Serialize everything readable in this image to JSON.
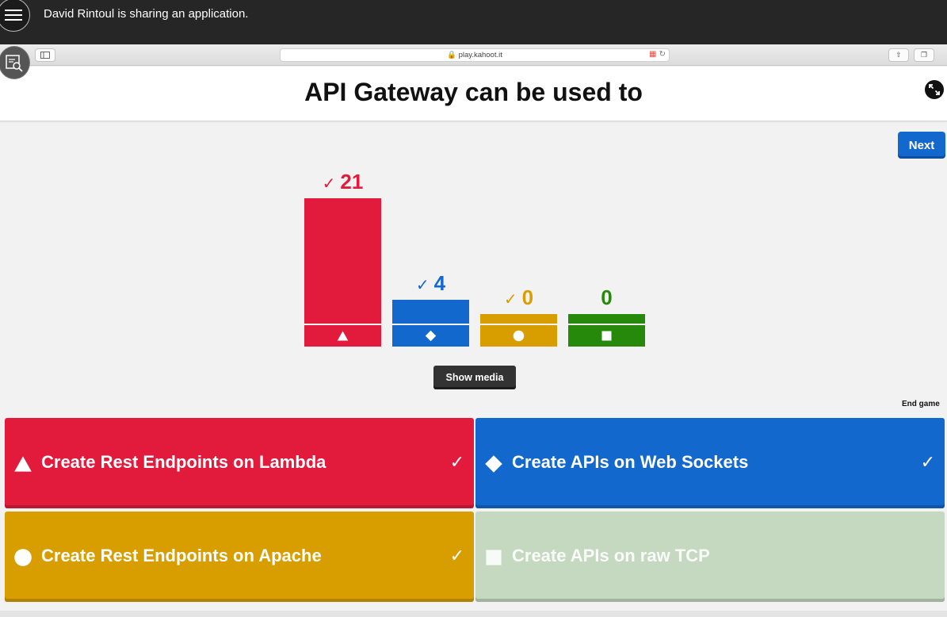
{
  "share_bar": {
    "message": "David Rintoul is sharing an application."
  },
  "browser": {
    "url": "play.kahoot.it"
  },
  "question": {
    "title": "API Gateway can be used to"
  },
  "controls": {
    "next_label": "Next",
    "show_media_label": "Show media",
    "end_game_label": "End game"
  },
  "colors": {
    "red": "#e21b3c",
    "blue": "#1368ce",
    "yellow": "#d89e00",
    "green": "#26890c",
    "green_faded": "#c5d9c0"
  },
  "chart_data": {
    "type": "bar",
    "categories": [
      "triangle",
      "diamond",
      "circle",
      "square"
    ],
    "values": [
      21,
      4,
      0,
      0
    ],
    "correct": [
      true,
      true,
      true,
      false
    ],
    "ylim": [
      0,
      21
    ]
  },
  "answers": [
    {
      "shape": "triangle",
      "text": "Create Rest Endpoints on Lambda",
      "correct": true,
      "faded": false
    },
    {
      "shape": "diamond",
      "text": "Create APIs on Web Sockets",
      "correct": true,
      "faded": false
    },
    {
      "shape": "circle",
      "text": "Create Rest Endpoints on Apache",
      "correct": true,
      "faded": false
    },
    {
      "shape": "square",
      "text": "Create APIs on raw TCP",
      "correct": false,
      "faded": true
    }
  ]
}
